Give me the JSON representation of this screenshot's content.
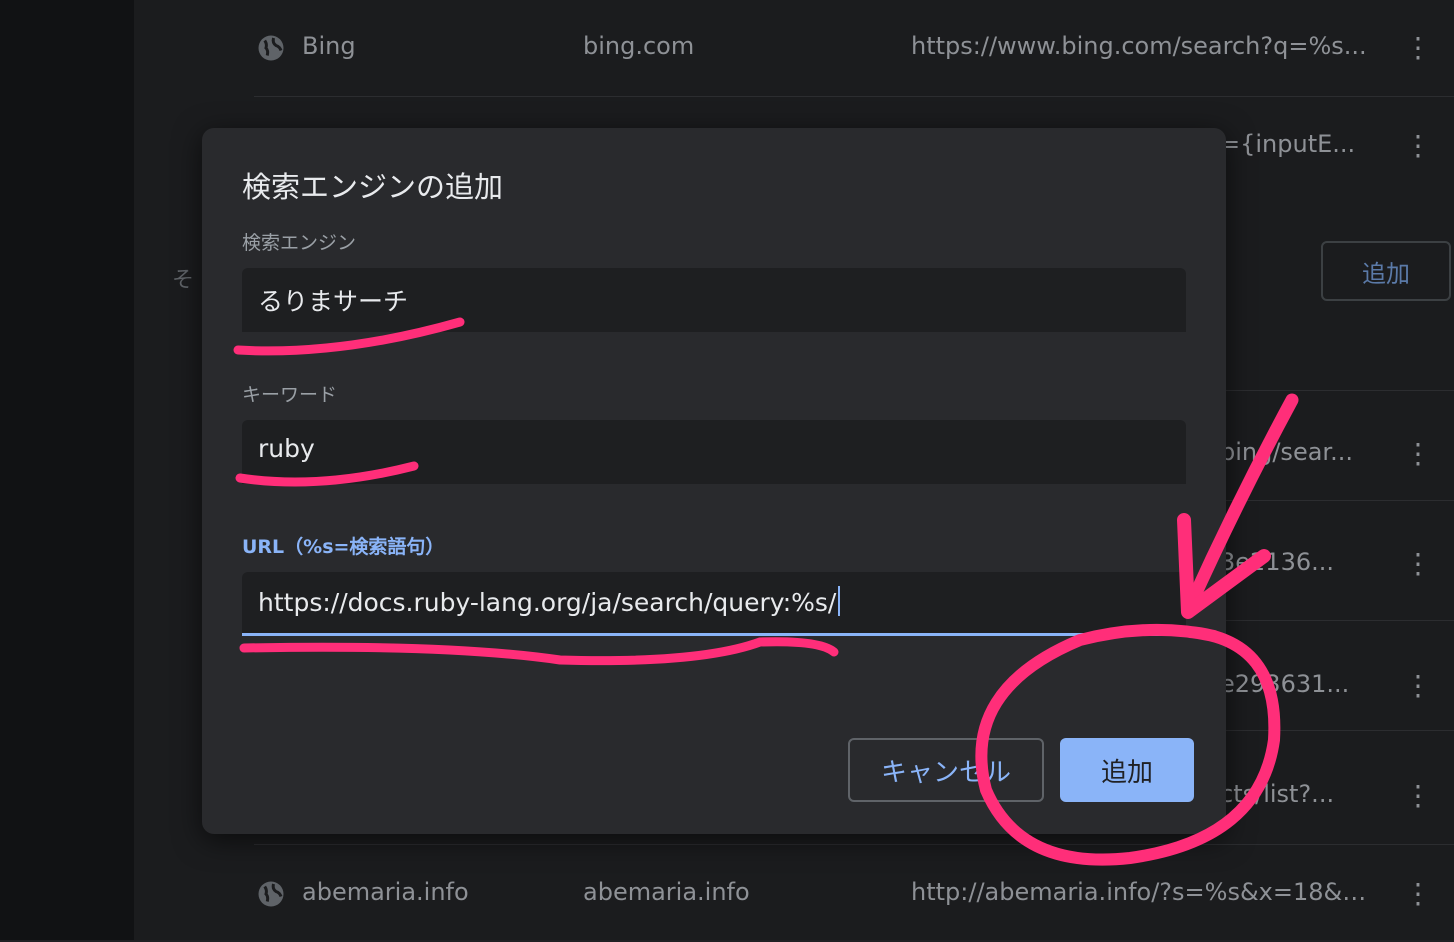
{
  "background_rows": [
    {
      "name": "Bing",
      "keyword": "bing.com",
      "url": "https://www.bing.com/search?q=%s..."
    },
    {
      "name": "abemaria.info",
      "keyword": "abemaria.info",
      "url": "http://abemaria.info/?s=%s&x=18&y..."
    }
  ],
  "background_partial_urls": [
    "={inputE...",
    "bing/sear...",
    "3e2136...",
    "e293631...",
    "cts/list?..."
  ],
  "background_section_char": "そ",
  "background_add_button": "追加",
  "dialog": {
    "title": "検索エンジンの追加",
    "engine_label": "検索エンジン",
    "engine_value": "るりまサーチ",
    "keyword_label": "キーワード",
    "keyword_value": "ruby",
    "url_label": "URL（%s=検索語句）",
    "url_value": "https://docs.ruby-lang.org/ja/search/query:%s/",
    "cancel_label": "キャンセル",
    "add_label": "追加"
  },
  "colors": {
    "accent": "#8ab4f8",
    "annotation": "#ff2e79",
    "dialog_bg": "#292a2d",
    "field_bg": "#1e1f21"
  },
  "icons": {
    "row_icon": "globe-icon",
    "row_menu": "more-vert-icon"
  }
}
